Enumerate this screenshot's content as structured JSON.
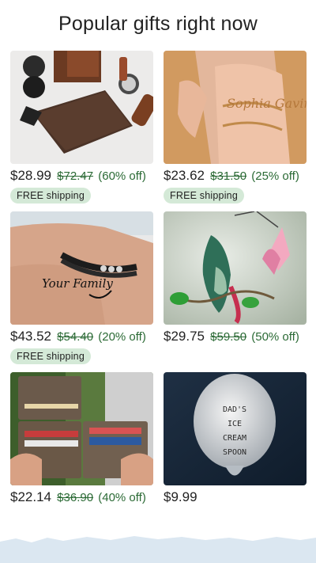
{
  "heading": "Popular gifts right now",
  "products": [
    {
      "image": "leather-wallet-gift-set-image",
      "price": "$28.99",
      "original_price": "$72.47",
      "discount": "(60% off)",
      "shipping": "FREE shipping"
    },
    {
      "image": "name-ring-image",
      "price": "$23.62",
      "original_price": "$31.50",
      "discount": "(25% off)",
      "shipping": "FREE shipping",
      "image_text": "Sophia Gavin"
    },
    {
      "image": "family-bracelet-image",
      "price": "$43.52",
      "original_price": "$54.40",
      "discount": "(20% off)",
      "shipping": "FREE shipping",
      "image_text": "Your Family"
    },
    {
      "image": "stained-glass-hummingbird-image",
      "price": "$29.75",
      "original_price": "$59.50",
      "discount": "(50% off)"
    },
    {
      "image": "engraved-wallet-image",
      "price": "$22.14",
      "original_price": "$36.90",
      "discount": "(40% off)"
    },
    {
      "image": "stamped-spoon-image",
      "price": "$9.99",
      "image_text": [
        "DAD'S",
        "ICE",
        "CREAM",
        "SPOON"
      ]
    }
  ],
  "colors": {
    "discount_green": "#2b6a35",
    "shipping_badge_bg": "#d4e9d7",
    "footer_band": "#dbe7f1"
  }
}
